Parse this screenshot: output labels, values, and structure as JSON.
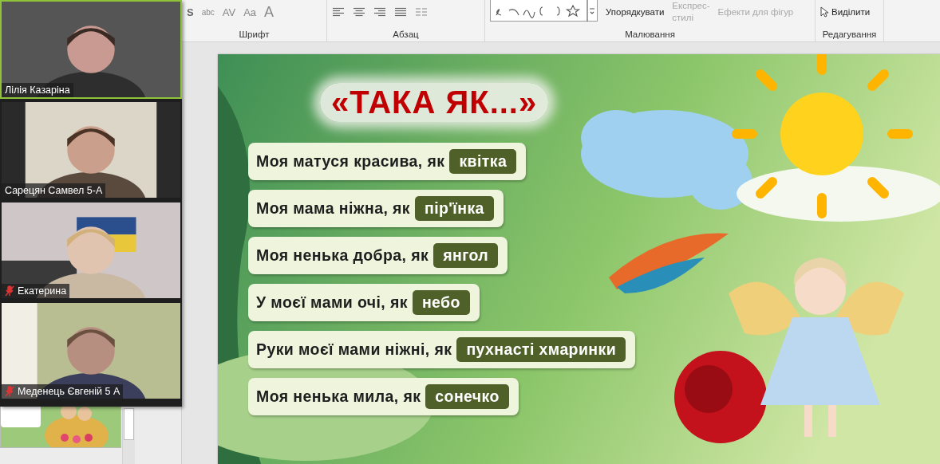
{
  "ribbon": {
    "font_tools": [
      "S",
      "abc",
      "AV",
      "Aa",
      "A"
    ],
    "groups": [
      {
        "label": "Шрифт"
      },
      {
        "label": "Абзац"
      },
      {
        "label": "Малювання"
      },
      {
        "label": "Редагування"
      }
    ],
    "drawing_commands": [
      {
        "lines": [
          "Упорядкувати"
        ],
        "disabled": false
      },
      {
        "lines": [
          "Експрес-",
          "стилі"
        ],
        "disabled": true
      },
      {
        "lines": [
          "Ефекти для фігур"
        ],
        "disabled": true
      }
    ],
    "editing_commands": [
      {
        "label": "Виділити",
        "disabled": false
      }
    ]
  },
  "participants": [
    {
      "name": "Лілія Казаріна",
      "muted": false,
      "speaking": true
    },
    {
      "name": "Сарецян Самвел 5-А",
      "muted": false,
      "speaking": false
    },
    {
      "name": "Екатерина",
      "muted": true,
      "speaking": false
    },
    {
      "name": "Меденець Євгеній 5 А",
      "muted": true,
      "speaking": false
    }
  ],
  "slide": {
    "title": "«ТАКА ЯК...»",
    "rows": [
      {
        "text": "Моя матуся красива, як",
        "answer": "квітка"
      },
      {
        "text": "Моя мама ніжна, як",
        "answer": "пір'їнка"
      },
      {
        "text": "Моя ненька добра, як",
        "answer": "янгол"
      },
      {
        "text": "У моєї мами очі, як",
        "answer": "небо"
      },
      {
        "text": "Руки моєї мами ніжні, як",
        "answer": "пухнасті хмаринки"
      },
      {
        "text": "Моя ненька мила, як",
        "answer": "сонечко"
      }
    ]
  }
}
